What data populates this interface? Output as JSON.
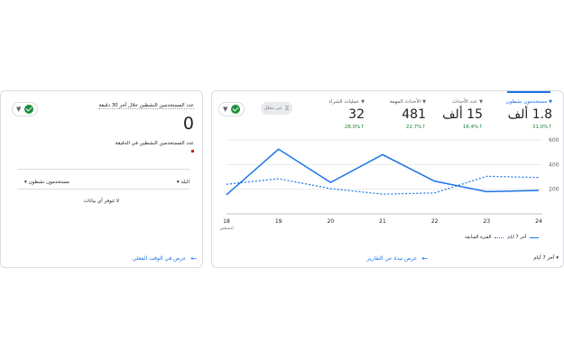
{
  "left_card": {
    "header_label": "عدد المستخدمين النشطين خلال آخر 30 دقيقة",
    "big_value": "0",
    "per_minute_label": "عدد المستخدمين النشطين في الدقيقة",
    "table_col_right": "البلد",
    "table_col_left": "مستخدمون نشطون",
    "empty_text": "لا تتوفر أي بيانات",
    "footer_link": "عرض في الوقت الفعلي"
  },
  "main_card": {
    "compare_label": "غير مفعّل",
    "metrics": [
      {
        "label": "مستخدمون نشطون",
        "value": "1.8 ألف",
        "change": "31.0%↑"
      },
      {
        "label": "عدد الأحداث",
        "value": "15 ألف",
        "change": "16.4%↑"
      },
      {
        "label": "الأحداث المهمة",
        "value": "481",
        "change": "22.7%↑"
      },
      {
        "label": "عمليات الشراء",
        "value": "32",
        "change": "28.0%↑"
      }
    ],
    "legend_current": "آخر 7 أيام",
    "legend_previous": "الفترة السابقة",
    "date_range": "آخر 7 أيام",
    "footer_link": "عرض نبذة عن التقارير"
  },
  "chart_data": {
    "type": "line",
    "x": [
      "18",
      "19",
      "20",
      "21",
      "22",
      "23",
      "24"
    ],
    "x_sublabel": "أغسطس",
    "ylim": [
      0,
      600
    ],
    "yticks": [
      "600",
      "400",
      "200"
    ],
    "series": [
      {
        "name": "آخر 7 أيام",
        "style": "solid",
        "values": [
          155,
          525,
          255,
          480,
          265,
          180,
          190
        ]
      },
      {
        "name": "الفترة السابقة",
        "style": "dotted",
        "values": [
          240,
          285,
          205,
          160,
          170,
          305,
          295
        ]
      }
    ],
    "color": "#1a73e8",
    "grid": true
  }
}
